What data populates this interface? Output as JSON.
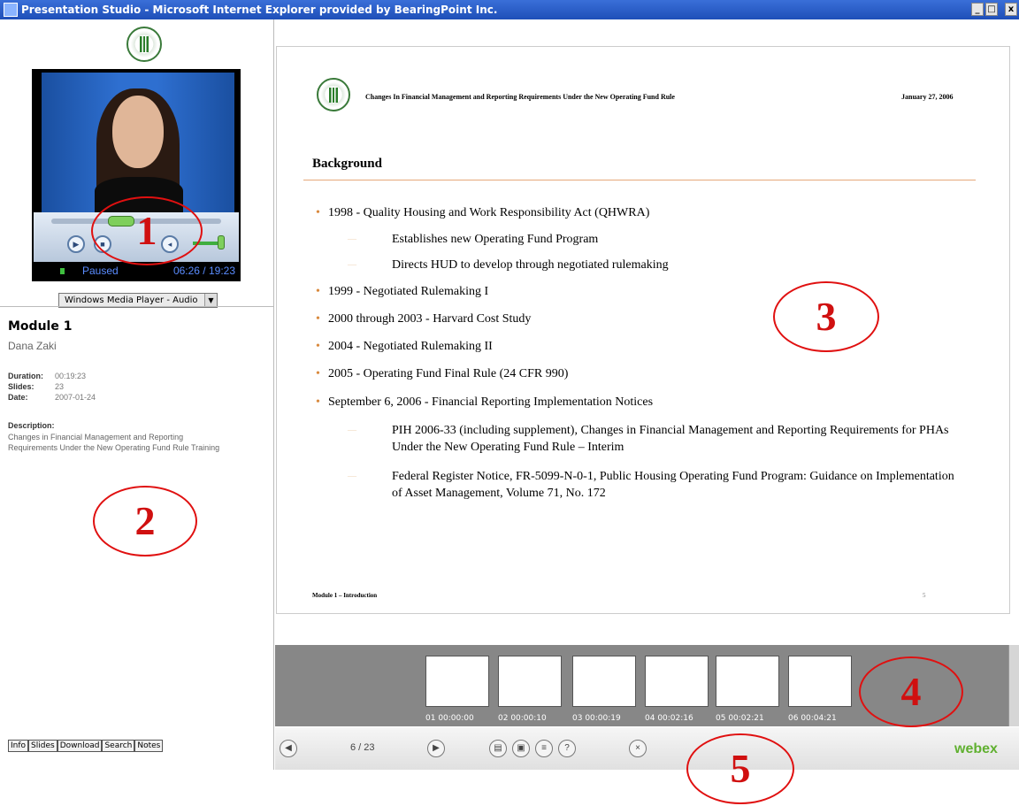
{
  "window": {
    "title": "Presentation Studio - Microsoft Internet Explorer provided by BearingPoint Inc.",
    "min": "_",
    "max": "□",
    "close": "x"
  },
  "player": {
    "status": "Paused",
    "time": "06:26 / 19:23",
    "selector": "Windows Media Player - Audio"
  },
  "info": {
    "module": "Module 1",
    "presenter": "Dana Zaki",
    "duration_label": "Duration:",
    "duration": "00:19:23",
    "slides_label": "Slides:",
    "slides": "23",
    "date_label": "Date:",
    "date": "2007-01-24",
    "description_label": "Description:",
    "description": "Changes in Financial Management and Reporting Requirements Under the New Operating Fund Rule Training"
  },
  "tabs": [
    "Info",
    "Slides",
    "Download",
    "Search",
    "Notes"
  ],
  "slide": {
    "header": "Changes In Financial Management and Reporting Requirements Under the New Operating Fund Rule",
    "date": "January 27, 2006",
    "heading": "Background",
    "bullets": [
      "1998 - Quality Housing and Work Responsibility Act (QHWRA)",
      "Establishes new Operating Fund Program",
      "Directs HUD to develop through negotiated rulemaking",
      "1999 - Negotiated Rulemaking I",
      "2000 through 2003 - Harvard Cost Study",
      "2004 - Negotiated Rulemaking II",
      "2005 - Operating Fund Final Rule (24 CFR 990)",
      "September 6, 2006 - Financial Reporting Implementation Notices",
      "PIH 2006-33 (including supplement), Changes in Financial Management and Reporting Requirements for PHAs Under the New Operating Fund Rule – Interim",
      "Federal Register Notice, FR-5099-N-0-1, Public Housing Operating Fund Program: Guidance on Implementation of Asset Management, Volume 71, No. 172"
    ],
    "footer": "Module 1 – Introduction",
    "page": "5"
  },
  "thumbnails": [
    {
      "label": "01 00:00:00"
    },
    {
      "label": "02 00:00:10"
    },
    {
      "label": "03 00:00:19"
    },
    {
      "label": "04 00:02:16"
    },
    {
      "label": "05 00:02:21"
    },
    {
      "label": "06 00:04:21"
    }
  ],
  "nav": {
    "counter": "6 / 23",
    "brand": "webex"
  },
  "callouts": [
    "1",
    "2",
    "3",
    "4",
    "5"
  ]
}
